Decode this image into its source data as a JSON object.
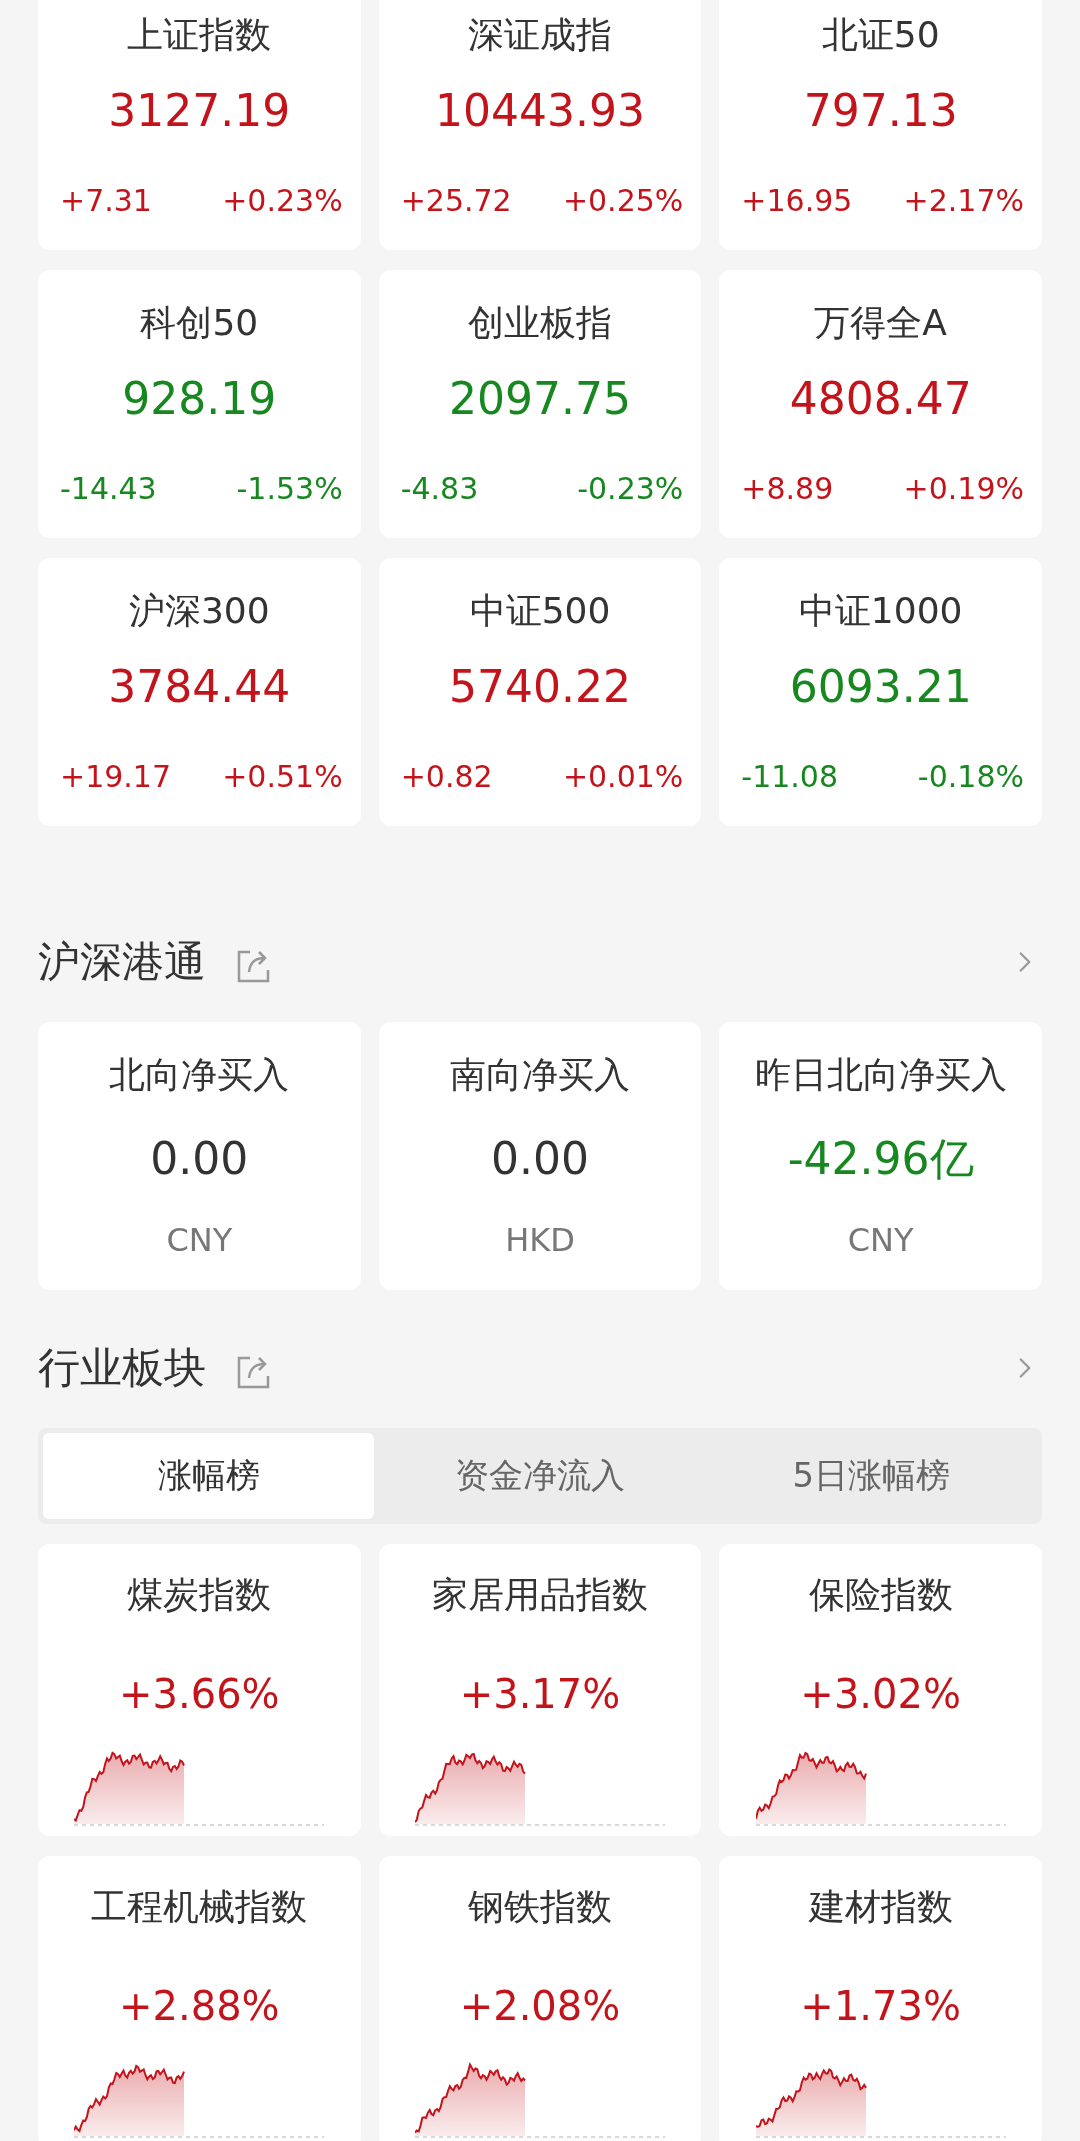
{
  "indices": [
    {
      "name": "上证指数",
      "value": "3127.19",
      "change": "+7.31",
      "change_pct": "+0.23%",
      "color": "#c4141b"
    },
    {
      "name": "深证成指",
      "value": "10443.93",
      "change": "+25.72",
      "change_pct": "+0.25%",
      "color": "#c4141b"
    },
    {
      "name": "北证50",
      "value": "797.13",
      "change": "+16.95",
      "change_pct": "+2.17%",
      "color": "#c4141b"
    },
    {
      "name": "科创50",
      "value": "928.19",
      "change": "-14.43",
      "change_pct": "-1.53%",
      "color": "#17871f"
    },
    {
      "name": "创业板指",
      "value": "2097.75",
      "change": "-4.83",
      "change_pct": "-0.23%",
      "color": "#17871f"
    },
    {
      "name": "万得全A",
      "value": "4808.47",
      "change": "+8.89",
      "change_pct": "+0.19%",
      "color": "#c4141b"
    },
    {
      "name": "沪深300",
      "value": "3784.44",
      "change": "+19.17",
      "change_pct": "+0.51%",
      "color": "#c4141b"
    },
    {
      "name": "中证500",
      "value": "5740.22",
      "change": "+0.82",
      "change_pct": "+0.01%",
      "color": "#c4141b"
    },
    {
      "name": "中证1000",
      "value": "6093.21",
      "change": "-11.08",
      "change_pct": "-0.18%",
      "color": "#17871f"
    }
  ],
  "connect": {
    "title": "沪深港通",
    "cards": [
      {
        "label": "北向净买入",
        "value": "0.00",
        "currency": "CNY",
        "color": "#333333"
      },
      {
        "label": "南向净买入",
        "value": "0.00",
        "currency": "HKD",
        "color": "#333333"
      },
      {
        "label": "昨日北向净买入",
        "value": "-42.96亿",
        "currency": "CNY",
        "color": "#17871f"
      }
    ]
  },
  "sectors": {
    "title": "行业板块",
    "tabs": [
      {
        "label": "涨幅榜",
        "selected": true
      },
      {
        "label": "资金净流入",
        "selected": false
      },
      {
        "label": "5日涨幅榜",
        "selected": false
      }
    ],
    "cards": [
      {
        "name": "煤炭指数",
        "change_pct": "+3.66%",
        "color": "#c4141b"
      },
      {
        "name": "家居用品指数",
        "change_pct": "+3.17%",
        "color": "#c4141b"
      },
      {
        "name": "保险指数",
        "change_pct": "+3.02%",
        "color": "#c4141b"
      },
      {
        "name": "工程机械指数",
        "change_pct": "+2.88%",
        "color": "#c4141b"
      },
      {
        "name": "钢铁指数",
        "change_pct": "+2.08%",
        "color": "#c4141b"
      },
      {
        "name": "建材指数",
        "change_pct": "+1.73%",
        "color": "#c4141b"
      }
    ]
  }
}
